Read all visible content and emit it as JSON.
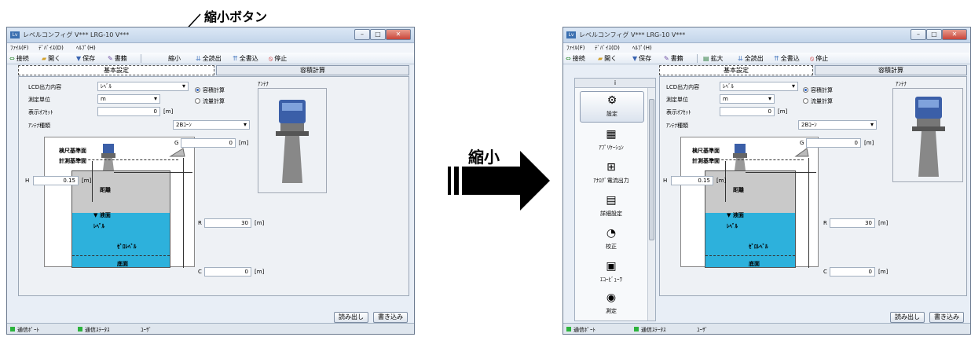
{
  "callout": {
    "label": "縮小ボタン"
  },
  "arrow": {
    "label": "縮小"
  },
  "window": {
    "title": "レベルコンフィグ V*** LRG-10 V***",
    "menu": [
      "ﾌｧｲﾙ(F)",
      "ﾃﾞﾊﾞｲｽ(D)",
      "ﾍﾙﾌﾟ(H)"
    ],
    "toolbar_common": {
      "connect": "接続",
      "open": "開く",
      "save": "保存",
      "write": "書籍",
      "read_all": "全読出",
      "write_all": "全書込",
      "stop": "停止"
    },
    "toolbar_a_toggle": "縮小",
    "toolbar_b_toggle": "拡大",
    "tabs": [
      "基本設定",
      "容積計算"
    ],
    "form": {
      "lcd_label": "LCD出力内容",
      "lcd_value": "ﾚﾍﾞﾙ",
      "unit_label": "測定単位",
      "unit_value": "m",
      "offset_label": "表示ｵﾌｾｯﾄ",
      "offset_value": "0",
      "offset_unit": "[m]",
      "antenna_label": "ｱﾝﾃﾅ種類",
      "antenna_value": "2Bｺｰﾝ",
      "radio_volume": "容積計算",
      "radio_flow": "流量計算",
      "antenna_img_label": "ｱﾝﾃﾅ"
    },
    "diagram": {
      "g_label": "G",
      "g_value": "0",
      "r_label": "R",
      "r_value": "30",
      "c_label": "C",
      "c_value": "0",
      "h_label": "H",
      "h_value": "0.15",
      "unit": "[m]",
      "ref1": "検尺基準面",
      "ref2": "計測基準面",
      "distance": "距離",
      "liquid": "液面",
      "level": "ﾚﾍﾞﾙ",
      "zero": "ｾﾞﾛﾚﾍﾞﾙ",
      "bottom": "底面"
    },
    "buttons": {
      "read": "読み出し",
      "write": "書き込み"
    },
    "status": {
      "port": "通信ﾎﾟｰﾄ",
      "comm": "通信ｽﾃｰﾀｽ",
      "user": "ﾕｰｻﾞ"
    },
    "sidebar": {
      "head": "i",
      "items": [
        {
          "label": "設定",
          "icon": "⚙"
        },
        {
          "label": "ｱﾌﾟﾘｹｰｼｮﾝ",
          "icon": "▦"
        },
        {
          "label": "ｱﾅﾛｸﾞ電流出力",
          "icon": "⊞"
        },
        {
          "label": "詳細設定",
          "icon": "▤"
        },
        {
          "label": "校正",
          "icon": "◔"
        },
        {
          "label": "ｴｺｰﾋﾞｭｰﾜ",
          "icon": "▣"
        },
        {
          "label": "測定",
          "icon": "◉"
        }
      ]
    }
  },
  "colors": {
    "water": "#2db1dc",
    "status_ok": "#2db33d",
    "titlebar": "#c3d5ea"
  }
}
